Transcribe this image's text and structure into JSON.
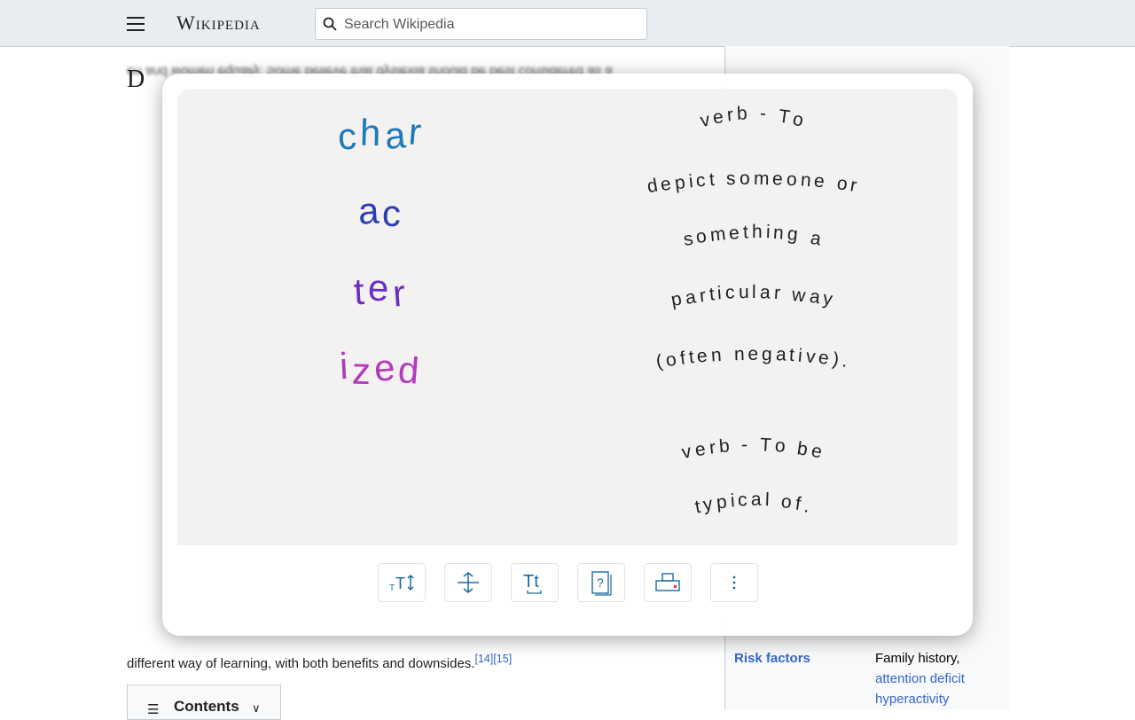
{
  "header": {
    "wordmark": "Wikipedia",
    "search_placeholder": "Search Wikipedia"
  },
  "article": {
    "heading": "D",
    "visible_fragments": [
      "en and women equally.  Some believe that dyslexia should be best considered as a",
      "[14][15]",
      "different way of learning, with both benefits and downsides."
    ],
    "footnote": "[14][15]"
  },
  "infobox": {
    "risk_factors_label": "Risk factors",
    "risk_factors_value": "Family history,",
    "risk_link_1": "attention deficit",
    "risk_link_2": "hyperactivity"
  },
  "contents": {
    "label": "Contents"
  },
  "syllables": {
    "word_parts": [
      "char",
      "ac",
      "ter",
      "ized"
    ],
    "colors": [
      "#1d7ab8",
      "#2d3fb0",
      "#6b2fc4",
      "#b23bbd"
    ]
  },
  "definitions": {
    "lines": [
      "verb - To",
      "depict someone or",
      "something a",
      "particular way",
      "(often negative).",
      "verb - To be",
      "typical of."
    ]
  },
  "toolbar": {
    "buttons": [
      {
        "name": "text-size-icon",
        "glyph": "TT↕"
      },
      {
        "name": "line-spacing-icon",
        "glyph": "↕"
      },
      {
        "name": "text-format-icon",
        "glyph": "Tt"
      },
      {
        "name": "picture-dictionary-icon",
        "glyph": "?"
      },
      {
        "name": "print-icon",
        "glyph": "print"
      },
      {
        "name": "more-options-icon",
        "glyph": "⋮"
      }
    ]
  }
}
